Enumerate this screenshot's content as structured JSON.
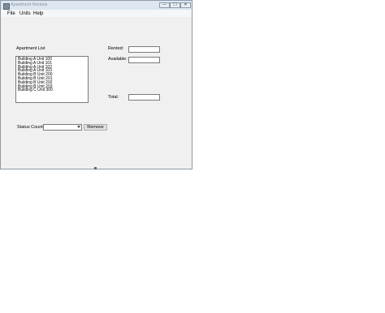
{
  "window": {
    "title": "Apartment Rentals",
    "caption_buttons": {
      "minimize": "—",
      "maximize": "☐",
      "close": "✕"
    }
  },
  "menu": {
    "file": "File",
    "units": "Units",
    "help": "Help"
  },
  "form": {
    "apartment_list_label": "Apartment List",
    "rented_label": "Rented:",
    "available_label": "Available:",
    "total_label": "Total:",
    "status_count_label": "Status Count:",
    "rented_value": "",
    "available_value": "",
    "total_value": "",
    "status_count_value": "",
    "remove_label": "Remove"
  },
  "apartments": [
    "Building A Unit 100",
    "Building A Unit 101",
    "Building A Unit 102",
    "Building A Unit 103",
    "Building B Unit 200",
    "Building B Unit 201",
    "Building B Unit 202",
    "Building B Unit 203",
    "Building C Unit 300"
  ],
  "icons": {
    "app": "app-icon",
    "combo_arrow": "chevron-down-icon",
    "grip": "resize-grip-icon"
  }
}
